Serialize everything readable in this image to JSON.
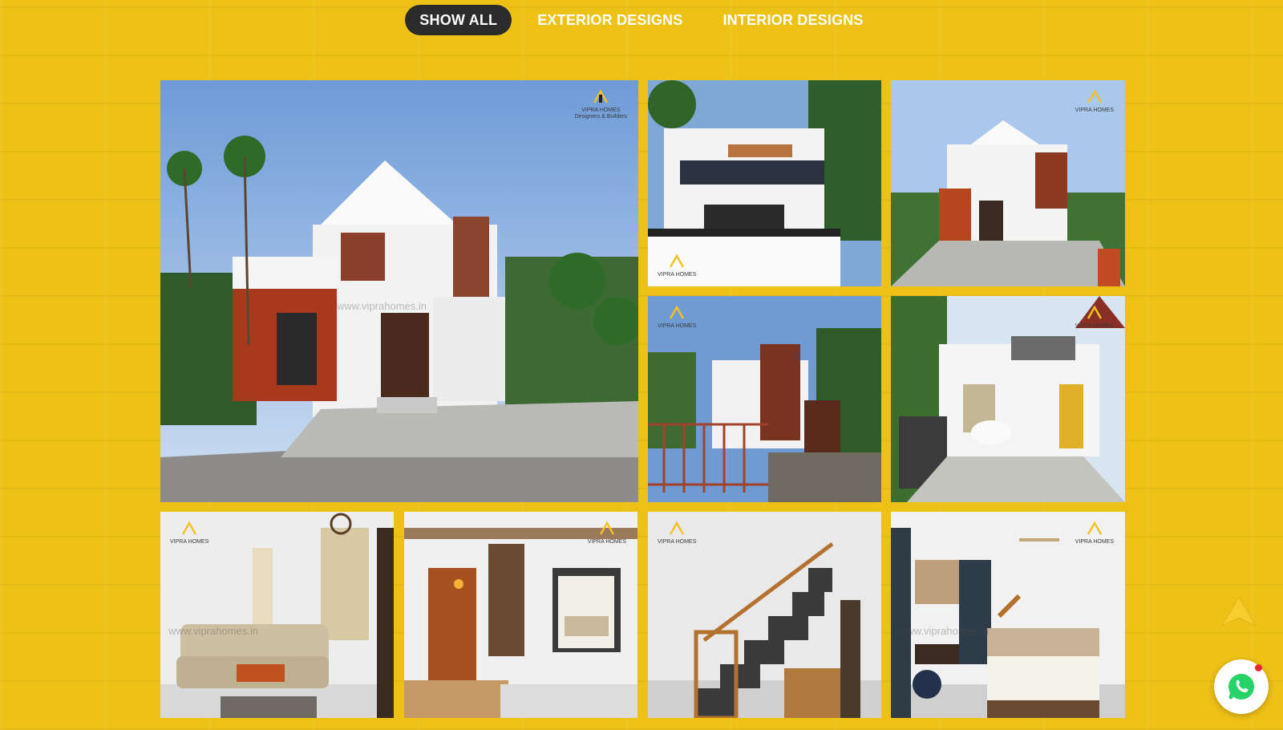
{
  "filters": {
    "show_all": "SHOW ALL",
    "exterior": "EXTERIOR DESIGNS",
    "interior": "INTERIOR DESIGNS",
    "active": "SHOW ALL"
  },
  "watermark": {
    "brand": "VIPRA HOMES",
    "tagline": "Designers & Builders",
    "url_text": "www.viprahomes.in"
  },
  "gallery": {
    "items": [
      {
        "category": "exterior",
        "alt": "Two-storey house with red cladding and white walls"
      },
      {
        "category": "exterior",
        "alt": "White house with black balcony railings"
      },
      {
        "category": "exterior",
        "alt": "House with brown accents and paved courtyard"
      },
      {
        "category": "exterior",
        "alt": "House with red gate and palm trees"
      },
      {
        "category": "exterior",
        "alt": "House with beige and green facade and parked car"
      },
      {
        "category": "interior",
        "alt": "Living room with beige sofa and wooden table"
      },
      {
        "category": "interior",
        "alt": "Dining area with wooden door and cabinets"
      },
      {
        "category": "interior",
        "alt": "Wooden staircase with lit steps"
      },
      {
        "category": "interior",
        "alt": "Bedroom with ceiling fan and blue wardrobe"
      }
    ]
  },
  "colors": {
    "background": "#eec117",
    "active_filter_bg": "#2b2b2b",
    "accent_arrow": "#f6cc2e",
    "whatsapp_green": "#25d366",
    "notification": "#e52b2b"
  },
  "icons": {
    "scroll_top": "chevron-up-icon",
    "chat": "whatsapp-icon"
  }
}
